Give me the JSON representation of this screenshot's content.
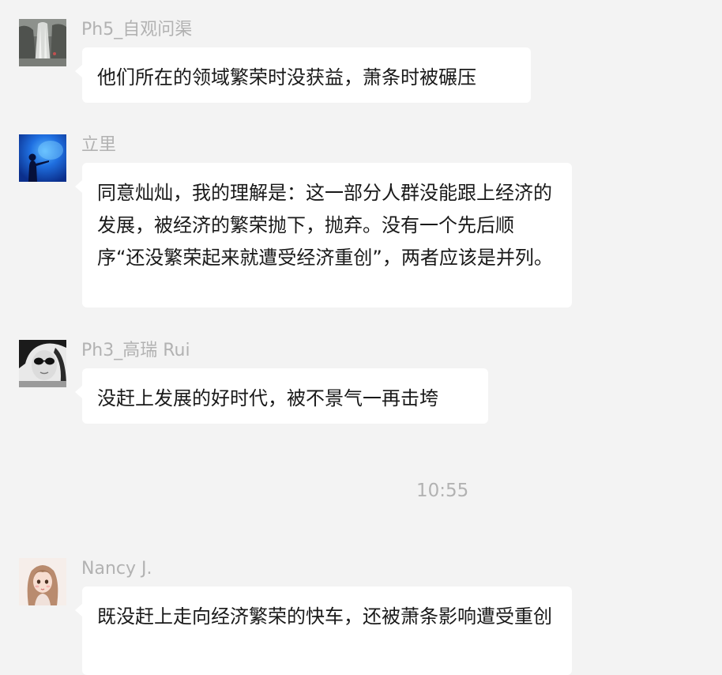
{
  "messages": [
    {
      "sender": "Ph5_自观问渠",
      "text": "他们所在的领域繁荣时没获益，萧条时被碾压",
      "avatar_icon": "waterfall-photo-avatar"
    },
    {
      "sender": "立里",
      "text": "同意灿灿，我的理解是：这一部分人群没能跟上经济的发展，被经济的繁荣抛下，抛弃。没有一个先后顺序“还没繁荣起来就遭受经济重创”，两者应该是并列。",
      "avatar_icon": "blue-aquarium-silhouette-avatar"
    },
    {
      "sender": "Ph3_高瑞 Rui",
      "text": "没赶上发展的好时代，被不景气一再击垮",
      "avatar_icon": "sunglasses-portrait-avatar"
    },
    {
      "sender": "Nancy J.",
      "text": "既没赶上走向经济繁荣的快车，还被萧条影响遭受重创",
      "avatar_icon": "cartoon-girl-avatar"
    }
  ],
  "timestamp": "10:55",
  "colors": {
    "background": "#f3f3f3",
    "bubble": "#ffffff",
    "sender_text": "#b2b2b2",
    "message_text": "#191919"
  }
}
